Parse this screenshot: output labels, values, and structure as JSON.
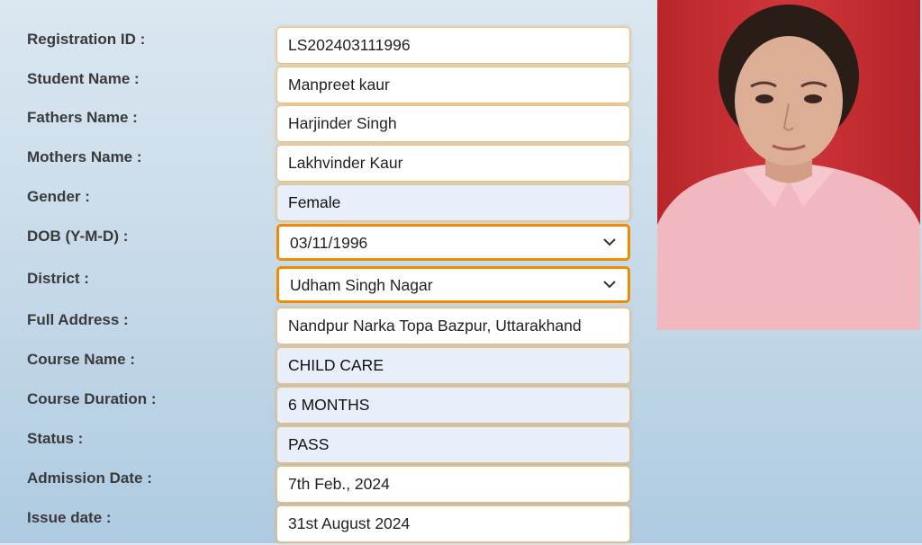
{
  "fields": [
    {
      "label": "Registration ID :",
      "value": "LS202403111996"
    },
    {
      "label": "Student Name :",
      "value": "Manpreet kaur"
    },
    {
      "label": "Fathers Name :",
      "value": "Harjinder Singh"
    },
    {
      "label": "Mothers Name :",
      "value": "Lakhvinder Kaur"
    },
    {
      "label": "Gender :",
      "value": "Female"
    },
    {
      "label": "DOB (Y-M-D) :",
      "value": "03/11/1996"
    },
    {
      "label": "District :",
      "value": "Udham Singh Nagar"
    },
    {
      "label": "Full Address :",
      "value": "Nandpur Narka Topa Bazpur, Uttarakhand"
    },
    {
      "label": "Course Name :",
      "value": "CHILD CARE"
    },
    {
      "label": "Course Duration :",
      "value": "6 MONTHS"
    },
    {
      "label": "Status :",
      "value": "PASS"
    },
    {
      "label": "Admission Date :",
      "value": "7th Feb., 2024"
    },
    {
      "label": "Issue date :",
      "value": "31st August 2024"
    }
  ],
  "colors": {
    "accent_border": "#f28a00",
    "readonly_bg": "#e9eefb",
    "photo_background": "#c42a2c"
  },
  "photo": {
    "icon": "student-photo"
  }
}
